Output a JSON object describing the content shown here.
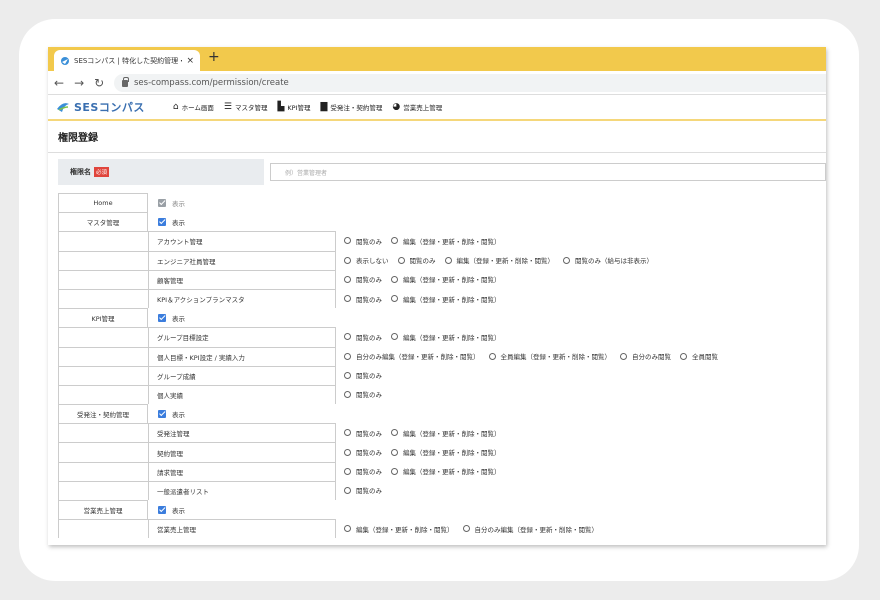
{
  "browser": {
    "tab_title": "SESコンパス | 特化した契約管理・営",
    "tab_close": "×",
    "new_tab": "+",
    "url": "ses-compass.com/permission/create"
  },
  "app": {
    "logo_text": "SESコンパス",
    "nav": [
      {
        "label": "ホーム画面",
        "icon": "home-icon"
      },
      {
        "label": "マスタ管理",
        "icon": "database-icon"
      },
      {
        "label": "KPI管理",
        "icon": "bar-chart-icon"
      },
      {
        "label": "受発注・契約管理",
        "icon": "document-icon"
      },
      {
        "label": "営業売上管理",
        "icon": "pie-chart-icon"
      }
    ]
  },
  "page": {
    "title": "権限登録",
    "name_label": "権限名",
    "required_badge": "必須",
    "name_placeholder": "例）営業管理者"
  },
  "permissions": {
    "show_label": "表示",
    "home": {
      "name": "Home",
      "checked": true,
      "disabled": true
    },
    "sections": [
      {
        "name": "マスタ管理",
        "items": [
          {
            "label": "アカウント管理",
            "options": [
              "閲覧のみ",
              "編集（登録・更新・削除・閲覧）"
            ]
          },
          {
            "label": "エンジニア社員管理",
            "options": [
              "表示しない",
              "閲覧のみ",
              "編集（登録・更新・削除・閲覧）",
              "閲覧のみ（給与は非表示）"
            ]
          },
          {
            "label": "顧客管理",
            "options": [
              "閲覧のみ",
              "編集（登録・更新・削除・閲覧）"
            ]
          },
          {
            "label": "KPI＆アクションプランマスタ",
            "options": [
              "閲覧のみ",
              "編集（登録・更新・削除・閲覧）"
            ]
          }
        ]
      },
      {
        "name": "KPI管理",
        "items": [
          {
            "label": "グループ目標設定",
            "options": [
              "閲覧のみ",
              "編集（登録・更新・削除・閲覧）"
            ]
          },
          {
            "label": "個人目標・KPI設定 / 実績入力",
            "options": [
              "自分のみ編集（登録・更新・削除・閲覧）",
              "全員編集（登録・更新・削除・閲覧）",
              "自分のみ閲覧",
              "全員閲覧"
            ]
          },
          {
            "label": "グループ成績",
            "options": [
              "閲覧のみ"
            ]
          },
          {
            "label": "個人実績",
            "options": [
              "閲覧のみ"
            ]
          }
        ]
      },
      {
        "name": "受発注・契約管理",
        "items": [
          {
            "label": "受発注管理",
            "options": [
              "閲覧のみ",
              "編集（登録・更新・削除・閲覧）"
            ]
          },
          {
            "label": "契約管理",
            "options": [
              "閲覧のみ",
              "編集（登録・更新・削除・閲覧）"
            ]
          },
          {
            "label": "請求管理",
            "options": [
              "閲覧のみ",
              "編集（登録・更新・削除・閲覧）"
            ]
          },
          {
            "label": "一般派遣者リスト",
            "options": [
              "閲覧のみ"
            ]
          }
        ]
      },
      {
        "name": "営業売上管理",
        "items": [
          {
            "label": "営業売上管理",
            "options": [
              "編集（登録・更新・削除・閲覧）",
              "自分のみ編集（登録・更新・削除・閲覧）"
            ]
          }
        ]
      }
    ]
  }
}
